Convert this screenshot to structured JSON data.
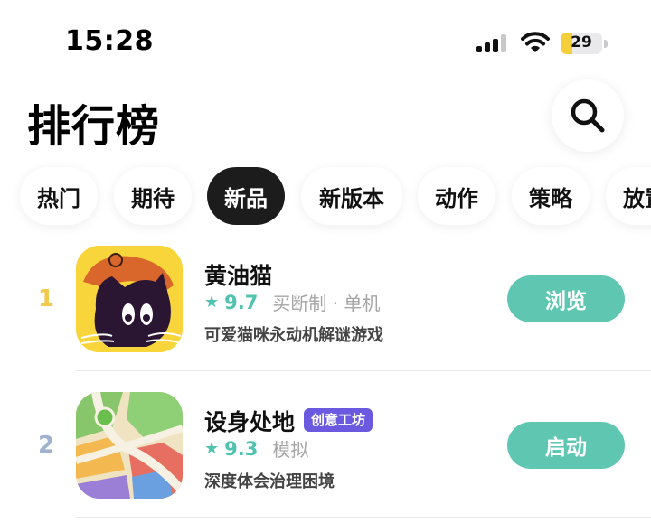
{
  "status_bar": {
    "time": "15:28",
    "battery": "29",
    "battery_color": "#f5cf3a",
    "icons": [
      "signal-icon",
      "wifi-icon",
      "battery-icon"
    ]
  },
  "header": {
    "title": "排行榜",
    "search_icon": "search-icon"
  },
  "tabs": [
    {
      "label": "热门",
      "active": false
    },
    {
      "label": "期待",
      "active": false
    },
    {
      "label": "新品",
      "active": true
    },
    {
      "label": "新版本",
      "active": false
    },
    {
      "label": "动作",
      "active": false
    },
    {
      "label": "策略",
      "active": false
    },
    {
      "label": "放置",
      "active": false
    }
  ],
  "rankings": [
    {
      "rank": "1",
      "rank_color": "#f2c94c",
      "name": "黄油猫",
      "badge": "",
      "star": "★",
      "score": "9.7",
      "tags": "买断制 · 单机",
      "description": "可爱猫咪永动机解谜游戏",
      "action": "浏览"
    },
    {
      "rank": "2",
      "rank_color": "#9fb3cf",
      "name": "设身处地",
      "badge": "创意工坊",
      "star": "★",
      "score": "9.3",
      "tags": "模拟",
      "description": "深度体会治理困境",
      "action": "启动"
    }
  ],
  "colors": {
    "accent": "#5fc7b1",
    "score": "#4fc3b0",
    "badge": "#6b5ae0",
    "active_tab": "#1c1c1c"
  }
}
